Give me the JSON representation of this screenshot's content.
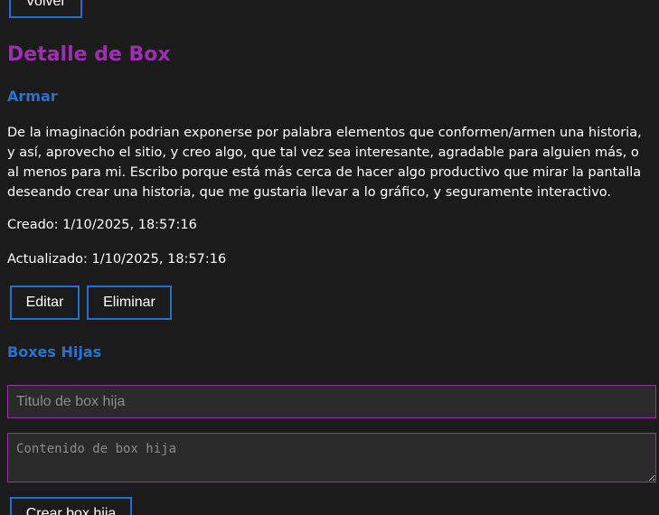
{
  "nav": {
    "back_label": "Volver"
  },
  "page": {
    "title": "Detalle de Box"
  },
  "box": {
    "title": "Armar",
    "content": "De la imaginación podrian exponerse por palabra elementos que conformen/armen una historia, y así, aprovecho el sitio, y creo algo, que tal vez sea interesante, agradable para alguien más, o al menos para mi. Escribo porque está más cerca de hacer algo productivo que mirar la pantalla deseando crear una historia, que me gustaria llevar a lo gráfico, y seguramente interactivo.",
    "created_label": "Creado:",
    "created_value": "1/10/2025, 18:57:16",
    "updated_label": "Actualizado:",
    "updated_value": "1/10/2025, 18:57:16"
  },
  "actions": {
    "edit_label": "Editar",
    "delete_label": "Eliminar"
  },
  "children": {
    "title": "Boxes Hijas",
    "title_input_placeholder": "Titulo de box hija",
    "title_input_value": "",
    "content_input_placeholder": "Contenido de box hija",
    "content_input_value": "",
    "create_label": "Crear box hija"
  },
  "colors": {
    "background": "#1b1b1c",
    "heading_purple": "#9b2fae",
    "heading_blue": "#2a72cf",
    "button_border": "#1f6fd4",
    "input_border": "#9b2fae"
  }
}
